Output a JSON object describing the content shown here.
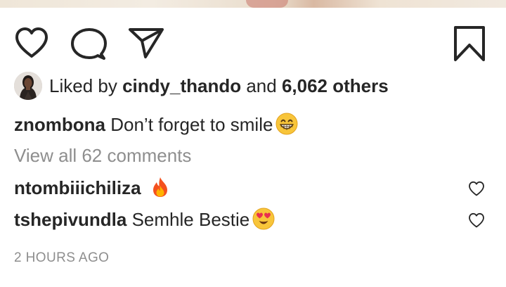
{
  "post": {
    "actions": {
      "like_icon": "heart-outline",
      "comment_icon": "speech-bubble-outline",
      "share_icon": "paper-plane-outline",
      "save_icon": "bookmark-outline"
    },
    "likes": {
      "prefix": "Liked by",
      "liker": "cindy_thando",
      "joiner": "and",
      "others": "6,062 others"
    },
    "caption": {
      "username": "znombona",
      "text": "Don’t forget to smile",
      "emoji": "grinning-face-with-smiling-eyes"
    },
    "view_all_comments": "View all 62 comments",
    "comments": [
      {
        "username": "ntombiiichiliza",
        "text": "",
        "emoji": "fire"
      },
      {
        "username": "tshepivundla",
        "text": "Semhle Bestie",
        "emoji": "smiling-face-with-heart-eyes"
      }
    ],
    "timestamp": "2 HOURS AGO"
  },
  "colors": {
    "text": "#262626",
    "secondary_text": "#8e8e8e"
  }
}
